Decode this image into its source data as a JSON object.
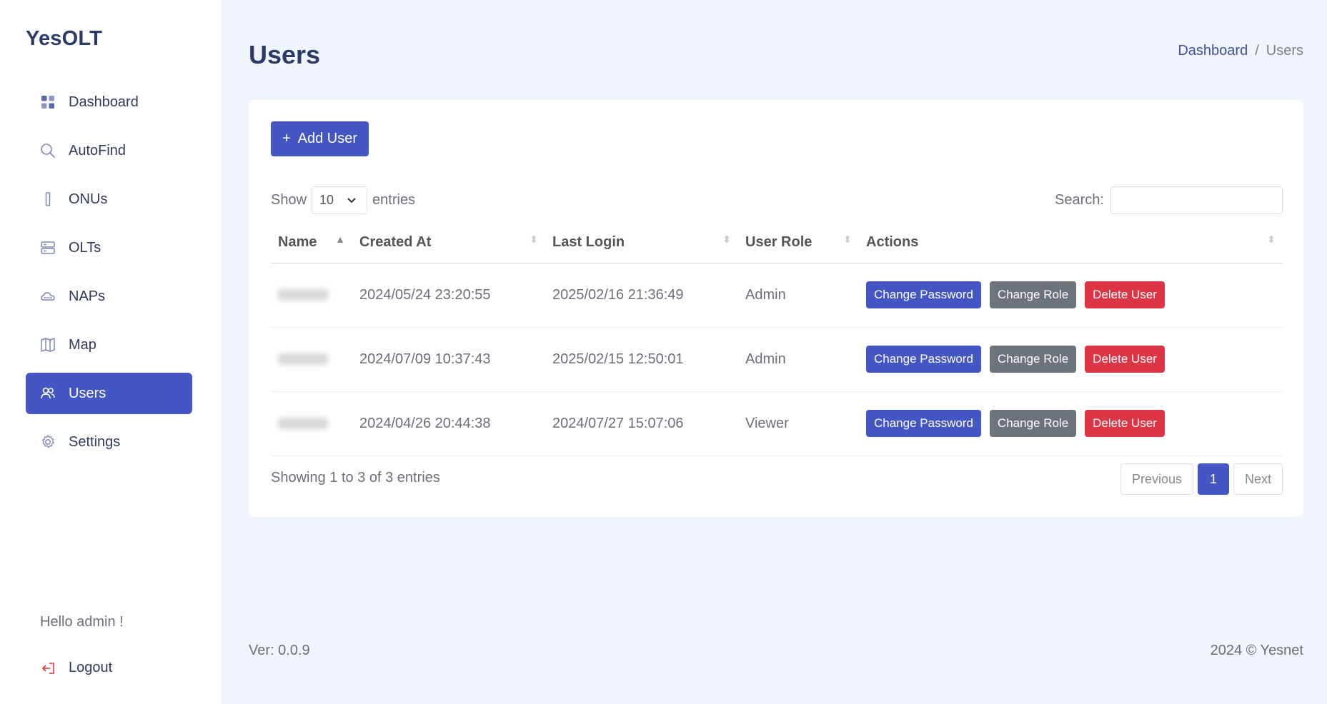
{
  "app": {
    "brand": "YesOLT"
  },
  "sidebar": {
    "items": [
      {
        "label": "Dashboard",
        "icon": "grid-icon",
        "active": false
      },
      {
        "label": "AutoFind",
        "icon": "search-icon",
        "active": false
      },
      {
        "label": "ONUs",
        "icon": "device-icon",
        "active": false
      },
      {
        "label": "OLTs",
        "icon": "server-icon",
        "active": false
      },
      {
        "label": "NAPs",
        "icon": "cloud-icon",
        "active": false
      },
      {
        "label": "Map",
        "icon": "map-icon",
        "active": false
      },
      {
        "label": "Users",
        "icon": "users-icon",
        "active": true
      },
      {
        "label": "Settings",
        "icon": "gear-icon",
        "active": false
      }
    ],
    "greeting": "Hello admin !",
    "logout_label": "Logout"
  },
  "header": {
    "title": "Users",
    "breadcrumb": {
      "home": "Dashboard",
      "separator": "/",
      "current": "Users"
    }
  },
  "toolbar": {
    "add_user_label": "Add User"
  },
  "table_controls": {
    "show_label": "Show",
    "entries_value": "10",
    "entries_label": "entries",
    "search_label": "Search:",
    "search_value": ""
  },
  "table": {
    "columns": [
      "Name",
      "Created At",
      "Last Login",
      "User Role",
      "Actions"
    ],
    "rows": [
      {
        "name": "",
        "created_at": "2024/05/24 23:20:55",
        "last_login": "2025/02/16 21:36:49",
        "role": "Admin"
      },
      {
        "name": "",
        "created_at": "2024/07/09 10:37:43",
        "last_login": "2025/02/15 12:50:01",
        "role": "Admin"
      },
      {
        "name": "",
        "created_at": "2024/04/26 20:44:38",
        "last_login": "2024/07/27 15:07:06",
        "role": "Viewer"
      }
    ],
    "actions": {
      "change_password": "Change Password",
      "change_role": "Change Role",
      "delete_user": "Delete User"
    }
  },
  "footer_table": {
    "info": "Showing 1 to 3 of 3 entries",
    "previous": "Previous",
    "page": "1",
    "next": "Next"
  },
  "footer": {
    "version": "Ver: 0.0.9",
    "copyright": "2024 © Yesnet"
  },
  "colors": {
    "primary": "#4456c4",
    "danger": "#dc3545",
    "secondary": "#6c737a",
    "background": "#f0f5fd"
  }
}
